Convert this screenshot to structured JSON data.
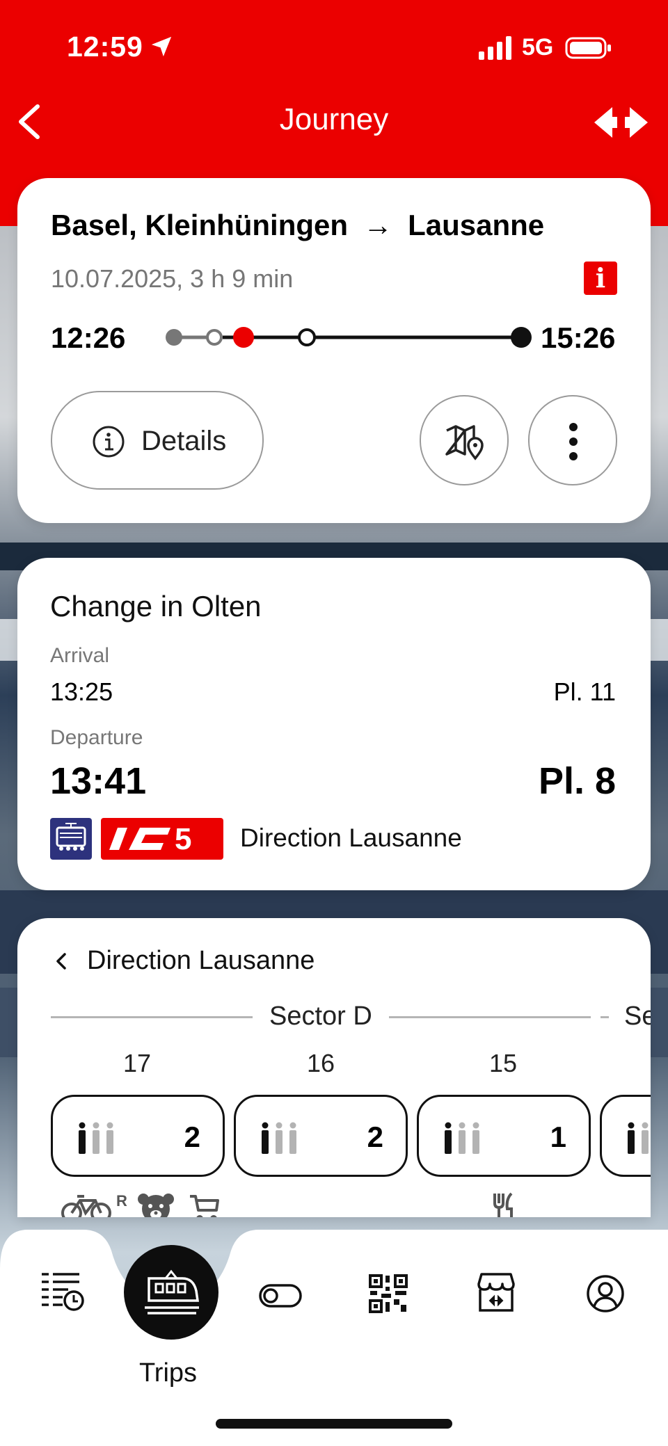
{
  "status_bar": {
    "time": "12:59",
    "network": "5G"
  },
  "nav": {
    "title": "Journey",
    "back_icon": "chevron-left-icon",
    "logo_icon": "sbb-logo-icon"
  },
  "journey": {
    "origin": "Basel, Kleinhüningen",
    "arrow": "→",
    "destination": "Lausanne",
    "date_duration": "10.07.2025, 3 h 9 min",
    "info_badge": "i",
    "departure_time": "12:26",
    "arrival_time": "15:26",
    "details_label": "Details"
  },
  "change": {
    "title": "Change in Olten",
    "arrival_label": "Arrival",
    "arrival_time": "13:25",
    "arrival_platform": "Pl. 11",
    "departure_label": "Departure",
    "departure_time": "13:41",
    "departure_platform": "Pl. 8",
    "train_line": "5",
    "direction": "Direction Lausanne"
  },
  "formation": {
    "direction": "Direction Lausanne",
    "sector": "Sector D",
    "next_sector_partial": "Se",
    "coaches": [
      {
        "number": "17",
        "class": "2"
      },
      {
        "number": "16",
        "class": "2"
      },
      {
        "number": "15",
        "class": "1"
      }
    ],
    "bike_reservation_mark": "R"
  },
  "tabbar": {
    "trips_label": "Trips"
  },
  "colors": {
    "brand_red": "#eb0000",
    "train_blue": "#2d327d"
  }
}
